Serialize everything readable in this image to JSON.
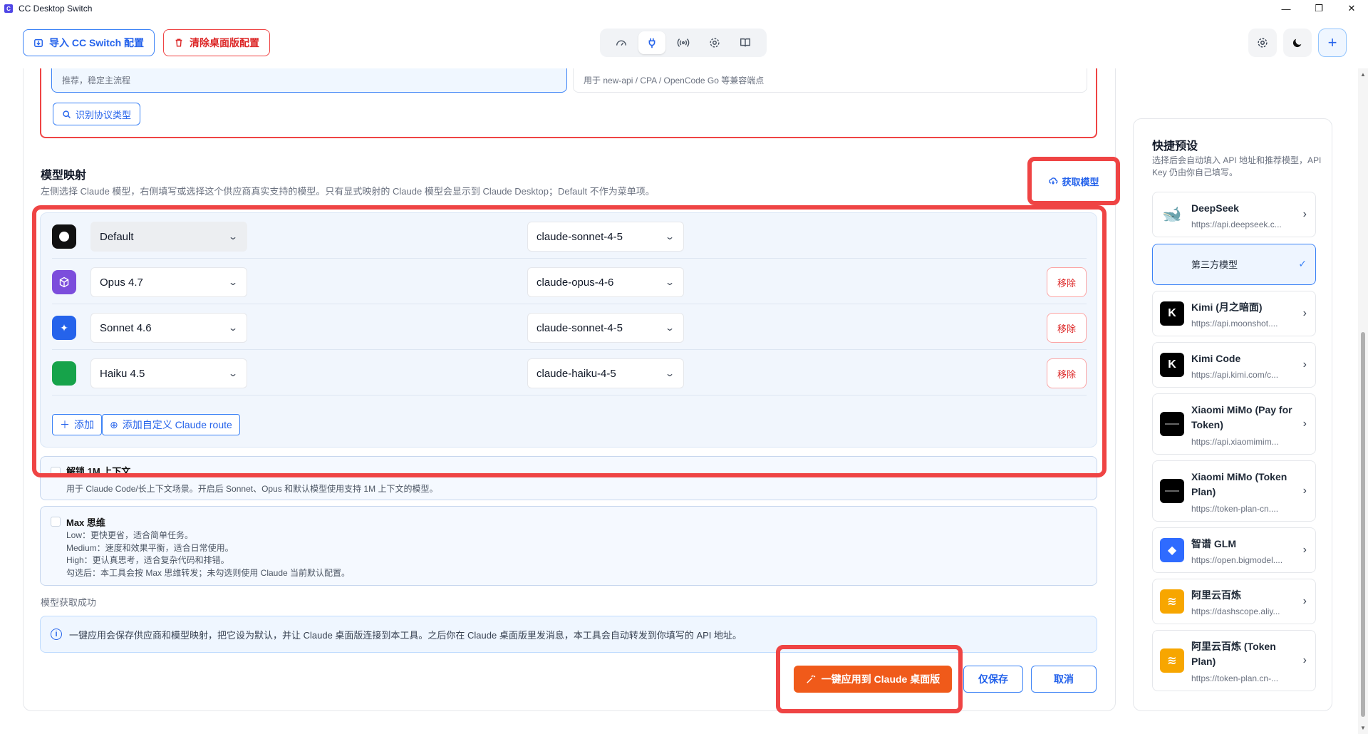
{
  "window": {
    "title": "CC Desktop Switch",
    "app_icon": "C"
  },
  "toolbar": {
    "import_label": "导入 CC Switch 配置",
    "clear_label": "清除桌面版配置"
  },
  "protocol": {
    "option_a_text": "推荐，稳定主流程",
    "option_b_text": "用于 new-api / CPA / OpenCode Go 等兼容端点",
    "detect_label": "识别协议类型"
  },
  "mapping": {
    "title": "模型映射",
    "description": "左侧选择 Claude 模型，右侧填写或选择这个供应商真实支持的模型。只有显式映射的 Claude 模型会显示到 Claude Desktop；Default 不作为菜单项。",
    "fetch_label": "获取模型",
    "rows": [
      {
        "left": "Default",
        "right": "claude-sonnet-4-5",
        "icon_color": "#111111",
        "removable": false
      },
      {
        "left": "Opus 4.7",
        "right": "claude-opus-4-6",
        "icon_color": "#7c4ddc",
        "removable": true
      },
      {
        "left": "Sonnet 4.6",
        "right": "claude-sonnet-4-5",
        "icon_color": "#2563eb",
        "removable": true
      },
      {
        "left": "Haiku 4.5",
        "right": "claude-haiku-4-5",
        "icon_color": "#16a34a",
        "removable": true
      }
    ],
    "remove_label": "移除",
    "add_label": "添加",
    "add_custom_label": "添加自定义 Claude route"
  },
  "context": {
    "title": "解锁 1M 上下文",
    "desc": "用于 Claude Code/长上下文场景。开启后 Sonnet、Opus 和默认模型使用支持 1M 上下文的模型。"
  },
  "thinking": {
    "title": "Max 思维",
    "lines": [
      "Low：更快更省，适合简单任务。",
      "Medium：速度和效果平衡，适合日常使用。",
      "High：更认真思考，适合复杂代码和排错。",
      "勾选后：本工具会按 Max 思维转发；未勾选则使用 Claude 当前默认配置。"
    ]
  },
  "status": "模型获取成功",
  "info": "一键应用会保存供应商和模型映射，把它设为默认，并让 Claude 桌面版连接到本工具。之后你在 Claude 桌面版里发消息，本工具会自动转发到你填写的 API 地址。",
  "actions": {
    "apply_label": "一键应用到 Claude 桌面版",
    "save_label": "仅保存",
    "cancel_label": "取消"
  },
  "presets": {
    "title": "快捷预设",
    "desc": "选择后会自动填入 API 地址和推荐模型，API Key 仍由你自己填写。",
    "items": [
      {
        "name": "DeepSeek",
        "url": "https://api.deepseek.c...",
        "logo_color": "#4d6bfe",
        "logo_text": "🐋",
        "active": false
      },
      {
        "name": "第三方模型",
        "url": "",
        "logo_color": "",
        "logo_text": "",
        "active": true
      },
      {
        "name": "Kimi (月之暗面)",
        "url": "https://api.moonshot....",
        "logo_color": "#000000",
        "logo_text": "K",
        "active": false
      },
      {
        "name": "Kimi Code",
        "url": "https://api.kimi.com/c...",
        "logo_color": "#000000",
        "logo_text": "K",
        "active": false
      },
      {
        "name": "Xiaomi MiMo (Pay for Token)",
        "url": "https://api.xiaomimim...",
        "logo_color": "#000000",
        "logo_text": "",
        "active": false
      },
      {
        "name": "Xiaomi MiMo (Token Plan)",
        "url": "https://token-plan-cn....",
        "logo_color": "#000000",
        "logo_text": "",
        "active": false
      },
      {
        "name": "智谱 GLM",
        "url": "https://open.bigmodel....",
        "logo_color": "#2f6bff",
        "logo_text": "◆",
        "active": false
      },
      {
        "name": "阿里云百炼",
        "url": "https://dashscope.aliy...",
        "logo_color": "#f7a600",
        "logo_text": "≋",
        "active": false
      },
      {
        "name": "阿里云百炼 (Token Plan)",
        "url": "https://token-plan.cn-...",
        "logo_color": "#f7a600",
        "logo_text": "≋",
        "active": false
      }
    ]
  }
}
